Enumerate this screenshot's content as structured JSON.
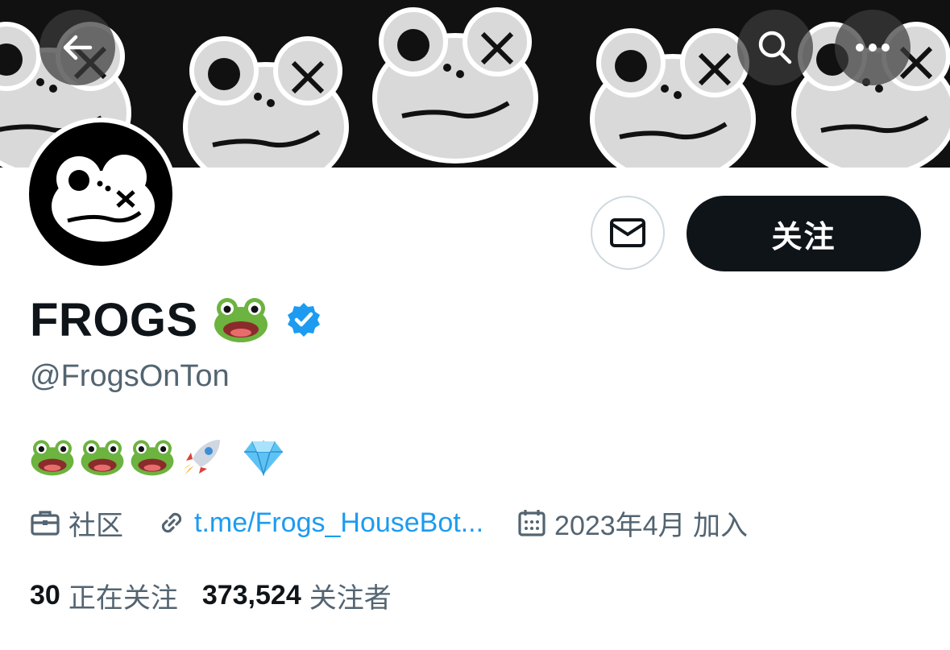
{
  "header": {
    "back_icon": "arrow-left-icon",
    "search_icon": "search-icon",
    "more_icon": "more-dots-icon"
  },
  "profile": {
    "display_name": "FROGS",
    "name_emoji": "🐸",
    "verified": true,
    "handle": "@FrogsOnTon",
    "bio": "🐸🐸🐸🚀 💎",
    "category": "社区",
    "link": "t.me/Frogs_HouseBot...",
    "joined": "2023年4月 加入"
  },
  "actions": {
    "follow_label": "关注",
    "message_icon": "envelope-icon"
  },
  "stats": {
    "following_count": "30",
    "following_label": "正在关注",
    "followers_count": "373,524",
    "followers_label": "关注者"
  },
  "colors": {
    "accent": "#1d9bf0",
    "text": "#0f1419",
    "secondary": "#536471",
    "button_bg": "#0f1419"
  }
}
